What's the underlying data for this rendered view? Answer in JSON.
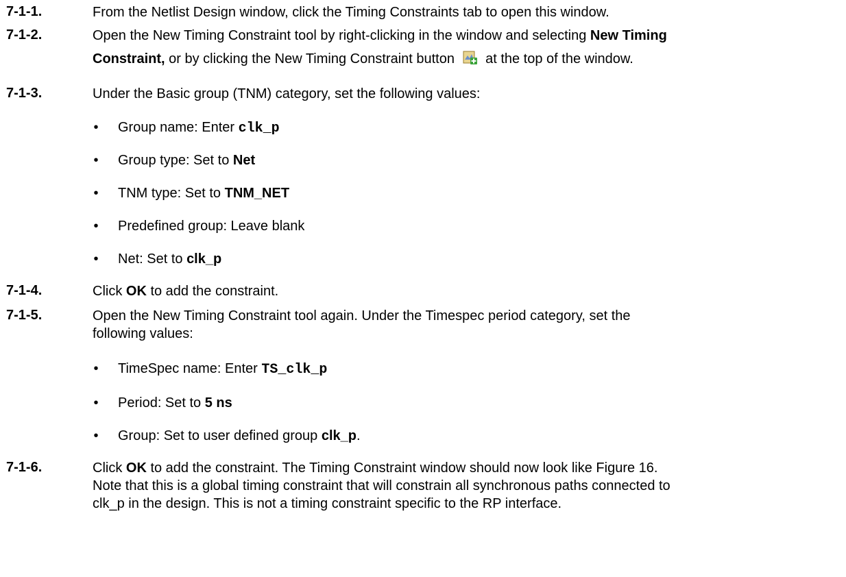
{
  "steps": [
    {
      "num": "7-1-1.",
      "text": "From the Netlist Design window, click the Timing Constraints tab to open this window."
    },
    {
      "num": "7-1-2.",
      "line1_a": "Open the New Timing Constraint tool by right-clicking in the window and selecting ",
      "line1_b": "New Timing",
      "line2_a": "Constraint,",
      "line2_b": " or by clicking the New Timing Constraint button ",
      "line2_c": " at the top of the window.",
      "icon": "new-constraint-icon"
    },
    {
      "num": "7-1-3.",
      "text": "Under the Basic group (TNM) category, set the following values:"
    },
    {
      "num": "7-1-4.",
      "a": "Click ",
      "b": "OK",
      "c": " to add the constraint."
    },
    {
      "num": "7-1-5.",
      "line1": "Open the New Timing Constraint tool again.  Under the Timespec period category, set the",
      "line2": "following values:"
    },
    {
      "num": "7-1-6.",
      "a": "Click ",
      "b": "OK",
      "c": " to add the constraint.  The Timing Constraint window should now look like Figure 16.",
      "line2": "Note that this is a global timing constraint that will constrain all synchronous paths connected to",
      "line3": "clk_p in the design.  This is not a timing constraint specific to the RP interface."
    }
  ],
  "tnm_bullets": [
    {
      "label": "Group name: Enter ",
      "value": "clk_p",
      "style": "mono"
    },
    {
      "label": "Group type: Set to ",
      "value": "Net",
      "style": "bold"
    },
    {
      "label": "TNM type: Set to ",
      "value": "TNM_NET",
      "style": "bold"
    },
    {
      "label": "Predefined group: Leave blank",
      "value": "",
      "style": "none"
    },
    {
      "label": "Net: Set to ",
      "value": "clk_p",
      "style": "bold"
    }
  ],
  "timespec_bullets": [
    {
      "label": "TimeSpec name: Enter ",
      "value": "TS_clk_p",
      "style": "mono",
      "suffix": ""
    },
    {
      "label": "Period: Set to ",
      "value": "5 ns",
      "style": "bold",
      "suffix": ""
    },
    {
      "label": "Group: Set to user defined group ",
      "value": "clk_p",
      "style": "bold",
      "suffix": "."
    }
  ],
  "bullet_char": "•",
  "colors": {
    "icon_body": "#d9c27a",
    "icon_plus": "#3aa33a"
  }
}
